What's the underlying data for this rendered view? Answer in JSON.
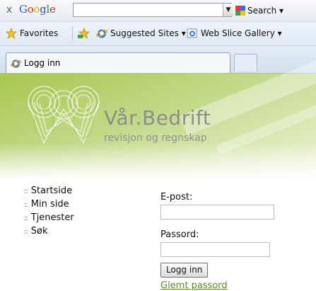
{
  "google_toolbar": {
    "close_glyph": "x",
    "logo_text": "Google",
    "search_value": "",
    "search_button_label": "Search ▾"
  },
  "favorites_bar": {
    "favorites_label": "Favorites",
    "suggested_sites_label": "Suggested Sites ▾",
    "web_slice_gallery_label": "Web Slice Gallery ▾"
  },
  "tabs": [
    {
      "title": "Logg inn"
    }
  ],
  "page": {
    "company_name": "Vår.Bedrift",
    "tagline": "revisjon og regnskap",
    "nav": [
      {
        "label": "Startside"
      },
      {
        "label": "Min side"
      },
      {
        "label": "Tjenester"
      },
      {
        "label": "Søk"
      }
    ],
    "form": {
      "email_label": "E-post:",
      "email_value": "",
      "password_label": "Passord:",
      "password_value": "",
      "login_button": "Logg inn",
      "forgot_link": "Glemt passord"
    }
  }
}
